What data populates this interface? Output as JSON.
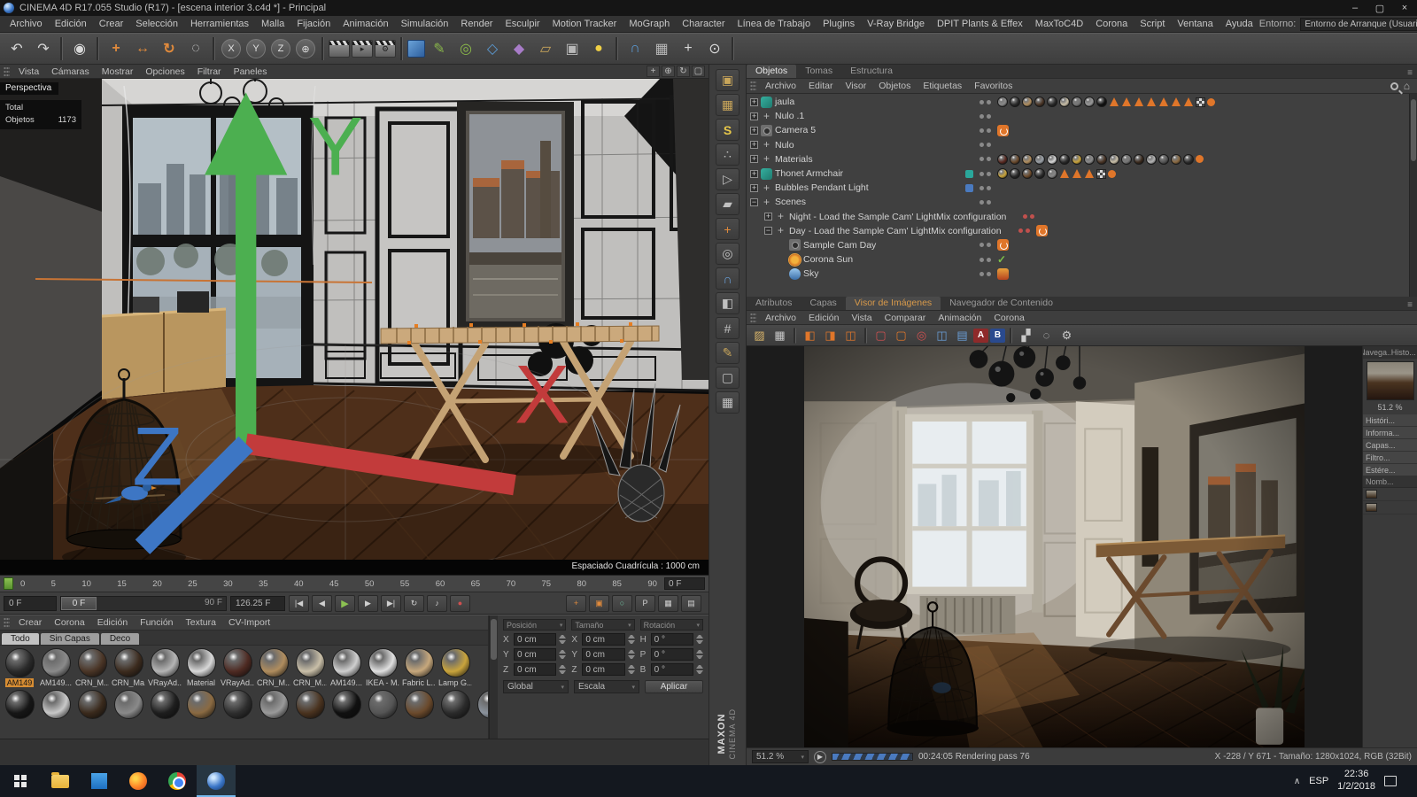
{
  "colors": {
    "accent_orange": "#e0762a",
    "accent_blue": "#4a7abf",
    "accent_green": "#8cc152",
    "selection": "#d78d33"
  },
  "window": {
    "title": "CINEMA 4D R17.055 Studio (R17) - [escena interior 3.c4d *] - Principal"
  },
  "menubar": {
    "items": [
      "Archivo",
      "Edición",
      "Crear",
      "Selección",
      "Herramientas",
      "Malla",
      "Fijación",
      "Animación",
      "Simulación",
      "Render",
      "Esculpir",
      "Motion Tracker",
      "MoGraph",
      "Character",
      "Línea de Trabajo",
      "Plugins",
      "V-Ray Bridge",
      "DPIT Plants & Effex",
      "MaxToC4D",
      "Corona",
      "Script",
      "Ventana",
      "Ayuda"
    ],
    "entorno_label": "Entorno:",
    "entorno_value": "Entorno de Arranque (Usuario)"
  },
  "toolbar": [
    {
      "name": "undo-icon",
      "glyph": "↶",
      "cls": "t-light"
    },
    {
      "name": "redo-icon",
      "glyph": "↷",
      "cls": "t-light"
    },
    {
      "name": "toolbar-divider",
      "cls": "t-div",
      "glyph": "",
      "inter": false
    },
    {
      "name": "live-selection-icon",
      "glyph": "◉",
      "cls": "t-light"
    },
    {
      "name": "toolbar-divider",
      "cls": "t-div",
      "glyph": "",
      "inter": false
    },
    {
      "name": "move-tool-icon",
      "glyph": "+",
      "cls": "t-orange"
    },
    {
      "name": "scale-tool-icon",
      "glyph": "↔",
      "cls": "t-orange"
    },
    {
      "name": "rotate-tool-icon",
      "glyph": "↻",
      "cls": "t-orange"
    },
    {
      "name": "last-tool-icon",
      "glyph": "◌",
      "cls": "t-light"
    },
    {
      "name": "toolbar-divider",
      "cls": "t-div",
      "glyph": "",
      "inter": false
    },
    {
      "name": "lock-x-axis-button",
      "glyph": "X",
      "cls": "t-circle"
    },
    {
      "name": "lock-y-axis-button",
      "glyph": "Y",
      "cls": "t-circle"
    },
    {
      "name": "lock-z-axis-button",
      "glyph": "Z",
      "cls": "t-circle"
    },
    {
      "name": "coordinate-system-button",
      "glyph": "⊕",
      "cls": "t-circle"
    },
    {
      "name": "toolbar-divider",
      "cls": "t-div",
      "glyph": "",
      "inter": false
    },
    {
      "name": "render-view-button",
      "glyph": "",
      "cls": "t-clapper"
    },
    {
      "name": "render-picture-viewer-button",
      "glyph": "▸",
      "cls": "t-clapper"
    },
    {
      "name": "render-settings-button",
      "glyph": "⚙",
      "cls": "t-clapper"
    },
    {
      "name": "toolbar-divider",
      "cls": "t-div",
      "glyph": "",
      "inter": false
    },
    {
      "name": "add-primitive-button",
      "glyph": "",
      "cls": "t-cube"
    },
    {
      "name": "add-spline-button",
      "glyph": "✎",
      "cls": "t-green"
    },
    {
      "name": "add-generator-button",
      "glyph": "◎",
      "cls": "t-green"
    },
    {
      "name": "add-modeling-button",
      "glyph": "◇",
      "cls": "t-blue"
    },
    {
      "name": "add-deformer-button",
      "glyph": "◆",
      "cls": "t-purple"
    },
    {
      "name": "add-environment-button",
      "glyph": "▱",
      "cls": "t-tan"
    },
    {
      "name": "add-camera-button",
      "glyph": "▣",
      "cls": "t-gray2"
    },
    {
      "name": "add-light-button",
      "glyph": "●",
      "cls": "t-yellow"
    },
    {
      "name": "toolbar-divider",
      "cls": "t-div",
      "glyph": "",
      "inter": false
    },
    {
      "name": "snap-toggle-button",
      "glyph": "∩",
      "cls": "t-blue"
    },
    {
      "name": "workplane-button",
      "glyph": "▦",
      "cls": "t-gray2"
    },
    {
      "name": "pan-viewport-button",
      "glyph": "+",
      "cls": "t-light"
    },
    {
      "name": "zoom-viewport-button",
      "glyph": "⊙",
      "cls": "t-light"
    },
    {
      "name": "toolbar-divider",
      "cls": "t-div",
      "glyph": "",
      "inter": false
    }
  ],
  "viewport": {
    "menu": [
      "Vista",
      "Cámaras",
      "Mostrar",
      "Opciones",
      "Filtrar",
      "Paneles"
    ],
    "view_icons": [
      {
        "name": "pan-view-icon",
        "glyph": "+"
      },
      {
        "name": "zoom-view-icon",
        "glyph": "⊕"
      },
      {
        "name": "rotate-view-icon",
        "glyph": "↻"
      },
      {
        "name": "toggle-view-icon",
        "glyph": "▢"
      }
    ],
    "label": "Perspectiva",
    "hud": {
      "total_label": "Total",
      "total_value": "",
      "objects_label": "Objetos",
      "objects_value": "1173"
    },
    "grid_label": "Espaciado Cuadrícula : 1000 cm"
  },
  "timeline": {
    "ticks": [
      "0",
      "5",
      "10",
      "15",
      "20",
      "25",
      "30",
      "35",
      "40",
      "45",
      "50",
      "55",
      "60",
      "65",
      "70",
      "75",
      "80",
      "85",
      "90"
    ],
    "end_field": "0 F"
  },
  "transport": {
    "frame_field": "0 F",
    "handle_label": "0 F",
    "range_end": "90 F",
    "rate_field": "126.25 F",
    "buttons": [
      {
        "name": "goto-start-button",
        "glyph": "|◀",
        "cls": ""
      },
      {
        "name": "previous-frame-button",
        "glyph": "◀",
        "cls": ""
      },
      {
        "name": "play-button",
        "glyph": "▶",
        "cls": "green"
      },
      {
        "name": "next-frame-button",
        "glyph": "▶",
        "cls": ""
      },
      {
        "name": "goto-end-button",
        "glyph": "▶|",
        "cls": ""
      },
      {
        "name": "play-mode-button",
        "glyph": "↻",
        "cls": ""
      },
      {
        "name": "sound-toggle-button",
        "glyph": "♪",
        "cls": ""
      },
      {
        "name": "record-button",
        "glyph": "●",
        "cls": "red"
      }
    ],
    "key_buttons": [
      {
        "name": "record-position-button",
        "glyph": "+",
        "cls": "orange"
      },
      {
        "name": "record-scale-button",
        "glyph": "▣",
        "cls": "orange"
      },
      {
        "name": "record-rotation-button",
        "glyph": "○",
        "cls": "green2"
      },
      {
        "name": "record-parameter-button",
        "glyph": "P",
        "cls": ""
      },
      {
        "name": "record-pla-button",
        "glyph": "▦",
        "cls": ""
      },
      {
        "name": "keyframe-selection-button",
        "glyph": "▤",
        "cls": ""
      }
    ]
  },
  "materials": {
    "menu": [
      "Crear",
      "Corona",
      "Edición",
      "Función",
      "Textura",
      "CV-Import"
    ],
    "tabs": [
      {
        "label": "Todo",
        "cls": "active"
      },
      {
        "label": "Sin Capas",
        "cls": ""
      },
      {
        "label": "Deco",
        "cls": ""
      }
    ],
    "row1": [
      {
        "name": "AM149",
        "color": "#2a2a2a",
        "sel": "sel"
      },
      {
        "name": "AM149...",
        "color": "#8a8a8a",
        "sel": ""
      },
      {
        "name": "CRN_M...",
        "color": "#4a3526",
        "sel": ""
      },
      {
        "name": "CRN_Ma...",
        "color": "#3c2b1e",
        "sel": ""
      },
      {
        "name": "VRayAd...",
        "color": "#b5b5b5",
        "sel": ""
      },
      {
        "name": "Material",
        "color": "#d8d8d8",
        "sel": ""
      },
      {
        "name": "VRayAd...",
        "color": "#4e2a22",
        "sel": ""
      },
      {
        "name": "CRN_M...",
        "color": "#b08d5e",
        "sel": ""
      },
      {
        "name": "CRN_M...",
        "color": "#c9bfa8",
        "sel": ""
      },
      {
        "name": "AM149...",
        "color": "#cfcfcf",
        "sel": ""
      },
      {
        "name": "IKEA - M...",
        "color": "#e0e0e0",
        "sel": ""
      },
      {
        "name": "Fabric L...",
        "color": "#c7a87c",
        "sel": ""
      },
      {
        "name": "Lamp G...",
        "color": "#c9a43c",
        "sel": ""
      }
    ],
    "row2": [
      {
        "color": "#161616"
      },
      {
        "color": "#c8c8c8"
      },
      {
        "color": "#3a2a1c"
      },
      {
        "color": "#8a8a8a"
      },
      {
        "color": "#1e1e1e"
      },
      {
        "color": "#8a6a42"
      },
      {
        "color": "#2e2e2e"
      },
      {
        "color": "#9a9a9a"
      },
      {
        "color": "#4a331f"
      },
      {
        "color": "#101010"
      },
      {
        "color": "#555555"
      },
      {
        "color": "#6b4a2c"
      },
      {
        "color": "#2b2b2b"
      },
      {
        "color": "#8a929c"
      }
    ]
  },
  "coordinates": {
    "headers": [
      "Posición",
      "Tamaño",
      "Rotación"
    ],
    "rows": [
      {
        "a_label": "X",
        "a_val": "0 cm",
        "b_label": "X",
        "b_val": "0 cm",
        "c_label": "H",
        "c_val": "0 °"
      },
      {
        "a_label": "Y",
        "a_val": "0 cm",
        "b_label": "Y",
        "b_val": "0 cm",
        "c_label": "P",
        "c_val": "0 °"
      },
      {
        "a_label": "Z",
        "a_val": "0 cm",
        "b_label": "Z",
        "b_val": "0 cm",
        "c_label": "B",
        "c_val": "0 °"
      }
    ],
    "mode_object": "Global",
    "mode_size": "Escala",
    "apply_label": "Aplicar"
  },
  "dock": [
    {
      "name": "model-mode-icon",
      "glyph": "▣",
      "cls": "d-tan"
    },
    {
      "name": "texture-mode-icon",
      "glyph": "▦",
      "cls": "d-tan"
    },
    {
      "name": "sculpt-icon",
      "glyph": "S",
      "cls": "d-gold"
    },
    {
      "name": "points-mode-icon",
      "glyph": "∴",
      "cls": "d-gray"
    },
    {
      "name": "edges-mode-icon",
      "glyph": "▷",
      "cls": "d-gray"
    },
    {
      "name": "polygons-mode-icon",
      "glyph": "▰",
      "cls": "d-gray"
    },
    {
      "name": "axis-mode-icon",
      "glyph": "+",
      "cls": "d-orange"
    },
    {
      "name": "normals-icon",
      "glyph": "◎",
      "cls": "d-gray"
    },
    {
      "name": "magnet-snap-icon",
      "glyph": "∩",
      "cls": "d-blue"
    },
    {
      "name": "mirror-icon",
      "glyph": "◧",
      "cls": "d-gray"
    },
    {
      "name": "measure-icon",
      "glyph": "#",
      "cls": "d-gray"
    },
    {
      "name": "pen-icon",
      "glyph": "✎",
      "cls": "d-tan"
    },
    {
      "name": "lock-icon",
      "glyph": "▢",
      "cls": "d-gray"
    },
    {
      "name": "grid-snap-icon",
      "glyph": "▦",
      "cls": "d-gray"
    }
  ],
  "brand": {
    "maxon": "MAXON",
    "cinema": "CINEMA 4D"
  },
  "object_manager": {
    "tabs": [
      {
        "label": "Objetos",
        "cls": "active"
      },
      {
        "label": "Tomas",
        "cls": ""
      },
      {
        "label": "Estructura",
        "cls": ""
      }
    ],
    "menu": [
      "Archivo",
      "Editar",
      "Visor",
      "Objetos",
      "Etiquetas",
      "Favoritos"
    ],
    "items": [
      {
        "name": "jaula",
        "depth_cls": "d0",
        "icon": "joint",
        "exp": "plus",
        "mark": "dots",
        "chip": "",
        "tags": {
          "spheres": [
            "#8a8a8a",
            "#2b2b2b",
            "#b08d5e",
            "#4a3526",
            "#2b2b2b",
            "#c9bfa8",
            "#777777",
            "#999999",
            "#111111"
          ],
          "tri": 7,
          "checker": true,
          "dot": true
        }
      },
      {
        "name": "Nulo .1",
        "depth_cls": "d0",
        "icon": "null",
        "exp": "plus",
        "mark": "dots",
        "chip": "",
        "tags": {}
      },
      {
        "name": "Camera 5",
        "depth_cls": "d0",
        "icon": "camera",
        "exp": "plus",
        "mark": "dots",
        "chip": "",
        "tags": {
          "corona": true
        }
      },
      {
        "name": "Nulo",
        "depth_cls": "d0",
        "icon": "null",
        "exp": "plus",
        "mark": "dots",
        "chip": "",
        "tags": {}
      },
      {
        "name": "Materials",
        "depth_cls": "d0",
        "icon": "null",
        "exp": "plus",
        "mark": "dots",
        "chip": "",
        "tags": {
          "spheres": [
            "#5a2a22",
            "#6b4a2c",
            "#b08d5e",
            "#9aa0a6",
            "#d8d8d8",
            "#2b2b2b",
            "#c9a43c",
            "#8a8a8a",
            "#4a3526",
            "#c9bfa8",
            "#777777",
            "#3c2b1e",
            "#b5b5b5",
            "#555555",
            "#8a6a42",
            "#2e2e2e"
          ],
          "dot": true
        }
      },
      {
        "name": "Thonet Armchair",
        "depth_cls": "d0",
        "icon": "joint",
        "exp": "plus",
        "mark": "dots",
        "chip": "#2aa79b",
        "tags": {
          "spheres": [
            "#c9a43c",
            "#2b2b2b",
            "#6b4a2c",
            "#2b2b2b",
            "#888888"
          ],
          "tri": 3,
          "checker": true,
          "dot": true
        }
      },
      {
        "name": "Bubbles Pendant Light",
        "depth_cls": "d0",
        "icon": "null",
        "exp": "plus",
        "mark": "dots",
        "chip": "#4a7abf",
        "tags": {}
      },
      {
        "name": "Scenes",
        "depth_cls": "d0",
        "icon": "null",
        "exp": "minus",
        "mark": "dots",
        "chip": "",
        "tags": {}
      },
      {
        "name": "Night  -   Load the Sample Cam' LightMix configuration",
        "depth_cls": "d1",
        "icon": "null",
        "exp": "plus",
        "mark": "dots-red",
        "chip": "",
        "tags": {}
      },
      {
        "name": "Day  -   Load the Sample Cam' LightMix configuration",
        "depth_cls": "d1",
        "icon": "null",
        "exp": "minus",
        "mark": "dots-red",
        "chip": "",
        "tags": {
          "corona": true
        }
      },
      {
        "name": "Sample Cam Day",
        "depth_cls": "d2",
        "icon": "camera",
        "exp": "",
        "mark": "dots",
        "chip": "",
        "tags": {
          "corona": true
        }
      },
      {
        "name": "Corona Sun",
        "depth_cls": "d2",
        "icon": "sun",
        "exp": "",
        "mark": "dots",
        "chip": "",
        "tags": {
          "check": true
        }
      },
      {
        "name": "Sky",
        "depth_cls": "d2",
        "icon": "sky",
        "exp": "",
        "mark": "dots",
        "chip": "",
        "tags": {
          "sky": true
        }
      }
    ]
  },
  "bottom_tabs": [
    {
      "label": "Atributos",
      "cls": ""
    },
    {
      "label": "Capas",
      "cls": ""
    },
    {
      "label": "Visor de Imágenes",
      "cls": "active-orange"
    },
    {
      "label": "Navegador de Contenido",
      "cls": ""
    }
  ],
  "viewer": {
    "menu": [
      "Archivo",
      "Edición",
      "Vista",
      "Comparar",
      "Animación",
      "Corona"
    ],
    "toolbar": [
      {
        "name": "open-image-button",
        "glyph": "▨",
        "cls": "v-tan"
      },
      {
        "name": "save-image-button",
        "glyph": "▦",
        "cls": "v-gray"
      },
      {
        "name": "viewer-divider",
        "glyph": "",
        "cls": "v-div",
        "inter": false
      },
      {
        "name": "compare-horizontal-button",
        "glyph": "◧",
        "cls": "v-orange"
      },
      {
        "name": "compare-vertical-button",
        "glyph": "◨",
        "cls": "v-orange"
      },
      {
        "name": "swap-ab-button",
        "glyph": "◫",
        "cls": "v-orange"
      },
      {
        "name": "viewer-divider",
        "glyph": "",
        "cls": "v-div",
        "inter": false
      },
      {
        "name": "frame-a-button",
        "glyph": "▢",
        "cls": "v-red"
      },
      {
        "name": "frame-b-button",
        "glyph": "▢",
        "cls": "v-orange"
      },
      {
        "name": "target-button",
        "glyph": "◎",
        "cls": "v-red"
      },
      {
        "name": "ab-compare-button",
        "glyph": "◫",
        "cls": "v-blue"
      },
      {
        "name": "layers-button",
        "glyph": "▤",
        "cls": "v-blue"
      },
      {
        "name": "version-a-button",
        "glyph": "A",
        "cls": "v-reda"
      },
      {
        "name": "version-b-button",
        "glyph": "B",
        "cls": "v-blueb"
      },
      {
        "name": "viewer-divider",
        "glyph": "",
        "cls": "v-div",
        "inter": false
      },
      {
        "name": "histogram-button",
        "glyph": "▞",
        "cls": "v-gray"
      },
      {
        "name": "info-button",
        "glyph": "◌",
        "cls": "v-gray"
      },
      {
        "name": "viewer-settings-button",
        "glyph": "⚙",
        "cls": "v-gray"
      }
    ],
    "sidebar": {
      "tabs": [
        "Navega...",
        "Histo..."
      ],
      "zoom": "51.2 %",
      "sections": [
        "Históri...",
        "Informa...",
        "Capas...",
        "Filtro...",
        "Estére..."
      ],
      "list_header": "Nomb..."
    },
    "status": {
      "zoom": "51.2 %",
      "progress": "00:24:05 Rendering pass 76",
      "info": "X -228 / Y 671 - Tamaño: 1280x1024, RGB (32Bit)"
    }
  },
  "taskbar": {
    "apps": [
      {
        "name": "file-explorer-icon",
        "kind": "ic-explorer",
        "active_cls": ""
      },
      {
        "name": "photos-app-icon",
        "kind": "ic-photos",
        "active_cls": ""
      },
      {
        "name": "firefox-icon",
        "kind": "ic-firefox",
        "active_cls": ""
      },
      {
        "name": "chrome-icon",
        "kind": "ic-chrome",
        "active_cls": ""
      },
      {
        "name": "cinema4d-taskbar-icon",
        "kind": "ic-c4d",
        "active_cls": "active"
      }
    ],
    "tray_chevron": "∧",
    "language": "ESP",
    "time": "22:36",
    "date": "1/2/2018"
  }
}
